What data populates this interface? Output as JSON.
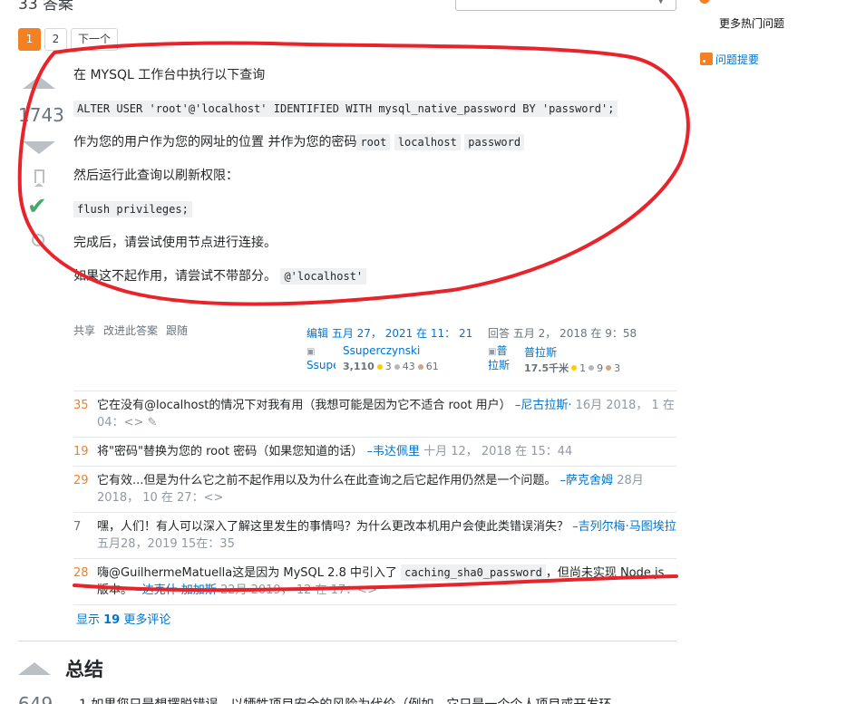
{
  "top": {
    "count_label": "33 答案",
    "sort_value": ""
  },
  "pager": {
    "pages": [
      "1",
      "2"
    ],
    "next": "下一个"
  },
  "sidebar": {
    "more_hot": "更多热门问题",
    "rss": "问题提要"
  },
  "vote": {
    "count": "1743"
  },
  "answer": {
    "p1": "在 MYSQL 工作台中执行以下查询",
    "code1": "ALTER USER 'root'@'localhost' IDENTIFIED WITH mysql_native_password BY 'password';",
    "p2_text": "作为您的用户作为您的网址的位置 并作为您的密码",
    "p2_code_a": "root",
    "p2_code_b": "localhost",
    "p2_code_c": "password",
    "p3": "然后运行此查询以刷新权限：",
    "code2": "flush privileges;",
    "p4": "完成后，请尝试使用节点进行连接。",
    "p5_text": "如果这不起作用，请尝试不带部分。",
    "p5_code": "@'localhost'"
  },
  "post_menu": {
    "share": "共享",
    "edit": "改进此答案",
    "follow": "跟随"
  },
  "edited": {
    "action": "编辑 五月 27， 2021 在 11： 21",
    "avatar_text": "Ssupe",
    "user": "Ssuperczynski",
    "rep": "3,110",
    "gold": "3",
    "silver": "43",
    "bronze": "61"
  },
  "answered": {
    "action": "回答 五月 2， 2018 在 9：58",
    "avatar_text": "普 拉斯",
    "user": "普拉斯",
    "rep": "17.5千米",
    "gold": "1",
    "silver": "9",
    "bronze": "3"
  },
  "comments": [
    {
      "score": "35",
      "text": "它在没有@localhost的情况下对我有用（我想可能是因为它不适合 root 用户）",
      "user": "–尼古拉斯·",
      "date": "16月 2018， 1 在 04：<> ✎"
    },
    {
      "score": "19",
      "text": "将\"密码\"替换为您的 root 密码（如果您知道的话）",
      "user": "–韦达佩里",
      "date": "十月 12， 2018 在 15：44"
    },
    {
      "score": "29",
      "text": "它有效...但是为什么它之前不起作用以及为什么在此查询之后它起作用仍然是一个问题。",
      "user": "–萨克舍姆",
      "date": "28月 2018， 10 在 27：<>"
    },
    {
      "score": "7",
      "text": "嘿，人们！有人可以深入了解这里发生的事情吗？为什么更改本机用户会使此类错误消失？",
      "user": "–吉列尔梅·马图埃拉",
      "date": "五月28，2019 15在：35"
    },
    {
      "score": "28",
      "text_a": "嗨@GuilhermeMatuella这是因为 MySQL 2.8 中引入了",
      "code": "caching_sha0_password",
      "text_b": "，但尚未实现 Node.js 版本。",
      "user": "–达克什·加加斯",
      "date": "22月 2019， 12 在 17：<>"
    }
  ],
  "show_more": {
    "prefix": "显示 ",
    "count": "19",
    "suffix": " 更多评论"
  },
  "next_answer": {
    "heading": "总结",
    "vote": "649",
    "text": "1.如果您只是想摆脱错误，以牺牲项目安全的风险为代价（例如，它只是一个个人项目或开发环"
  },
  "colors": {
    "accent": "#f48024",
    "link": "#0074cc",
    "annotation": "#e8232a"
  }
}
